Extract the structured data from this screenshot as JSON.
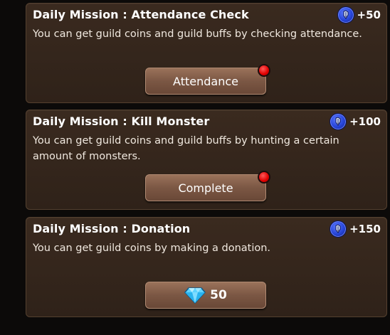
{
  "missions": [
    {
      "title": "Daily Mission : Attendance Check",
      "reward": "+50",
      "reward_icon": "guild-coin-icon",
      "description": "You can get guild coins and guild buffs by checking attendance.",
      "button_label": "Attendance",
      "notification": true
    },
    {
      "title": "Daily Mission : Kill Monster",
      "reward": "+100",
      "reward_icon": "guild-coin-icon",
      "description": "You can get guild coins and guild buffs by hunting a certain amount of monsters.",
      "button_label": "Complete",
      "notification": true
    },
    {
      "title": "Daily Mission : Donation",
      "reward": "+150",
      "reward_icon": "guild-coin-icon",
      "description": "You can get guild coins by making a donation.",
      "button_cost": "50",
      "button_icon": "diamond-icon",
      "notification": false
    }
  ],
  "colors": {
    "card_bg": "#35271d",
    "button": "#7b5744",
    "coin": "#2543d6",
    "notification": "#e00000"
  }
}
